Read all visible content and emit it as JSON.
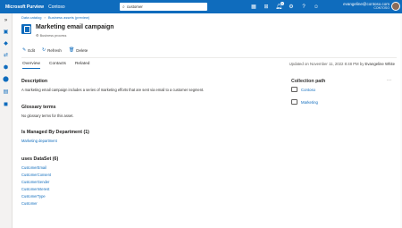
{
  "header": {
    "brand": "Microsoft Purview",
    "tenant": "Contoso",
    "search_value": "customer",
    "notification_count": "1",
    "user_email": "evangeline@contoso.com",
    "user_org": "CONTOSO"
  },
  "breadcrumb": {
    "items": [
      "Data catalog",
      "Business assets (preview)"
    ]
  },
  "asset": {
    "title": "Marketing email campaign",
    "type": "Business process"
  },
  "actions": {
    "edit": "Edit",
    "refresh": "Refresh",
    "delete": "Delete"
  },
  "tabs": [
    "Overview",
    "Contacts",
    "Related"
  ],
  "updated": {
    "prefix": "Updated on November 11, 2022 8:48 PM by",
    "user": "Evangeline White"
  },
  "description": {
    "heading": "Description",
    "text": "A marketing email campaign includes a series of marketing efforts that are sent via email to a customer segment."
  },
  "glossary": {
    "heading": "Glossary terms",
    "text": "No glossary terms for this asset."
  },
  "managed": {
    "heading": "Is Managed By Department (1)",
    "items": [
      "Marketing department"
    ]
  },
  "uses": {
    "heading": "uses DataSet (6)",
    "items": [
      "CustomerEmail",
      "CustomerConsent",
      "CustomerGender",
      "CustomerInterest",
      "CustomerType",
      "Customer"
    ]
  },
  "collection": {
    "heading": "Collection path",
    "items": [
      "Contoso",
      "Marketing"
    ]
  },
  "colors": {
    "accent": "#0f6cbd",
    "topbar": "#0f6cbd"
  }
}
